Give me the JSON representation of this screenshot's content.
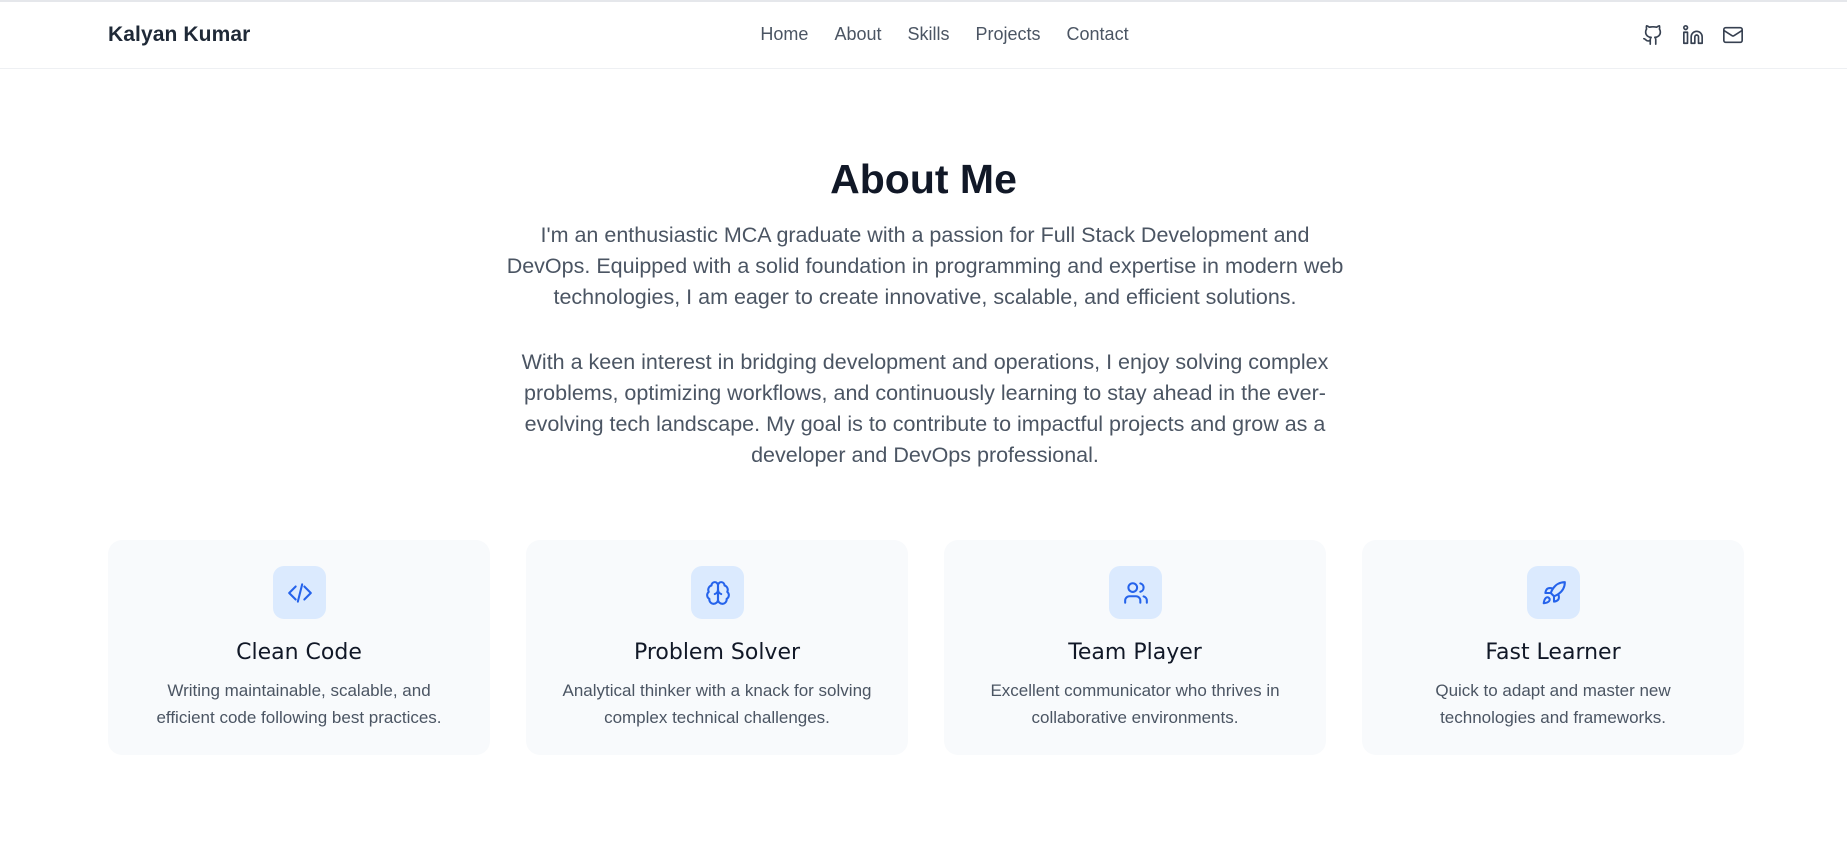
{
  "header": {
    "brand": "Kalyan Kumar",
    "nav": [
      "Home",
      "About",
      "Skills",
      "Projects",
      "Contact"
    ],
    "socials": [
      "github-icon",
      "linkedin-icon",
      "mail-icon"
    ]
  },
  "about": {
    "title": "About Me",
    "paragraph1": "I'm an enthusiastic MCA graduate with a passion for Full Stack Development and DevOps. Equipped with a solid foundation in programming and expertise in modern web technologies, I am eager to create innovative, scalable, and efficient solutions.",
    "paragraph2": "With a keen interest in bridging development and operations, I enjoy solving complex problems, optimizing workflows, and continuously learning to stay ahead in the ever-evolving tech landscape. My goal is to contribute to impactful projects and grow as a developer and DevOps professional."
  },
  "cards": [
    {
      "icon": "code-icon",
      "title": "Clean Code",
      "text": "Writing maintainable, scalable, and efficient code following best practices."
    },
    {
      "icon": "brain-icon",
      "title": "Problem Solver",
      "text": "Analytical thinker with a knack for solving complex technical challenges."
    },
    {
      "icon": "users-icon",
      "title": "Team Player",
      "text": "Excellent communicator who thrives in collaborative environments."
    },
    {
      "icon": "rocket-icon",
      "title": "Fast Learner",
      "text": "Quick to adapt and master new technologies and frameworks."
    }
  ],
  "colors": {
    "accent": "#2563eb",
    "accent_bg": "#dbeafe",
    "card_bg": "#f8fafc",
    "heading": "#111827",
    "body_text": "#4b5563"
  }
}
